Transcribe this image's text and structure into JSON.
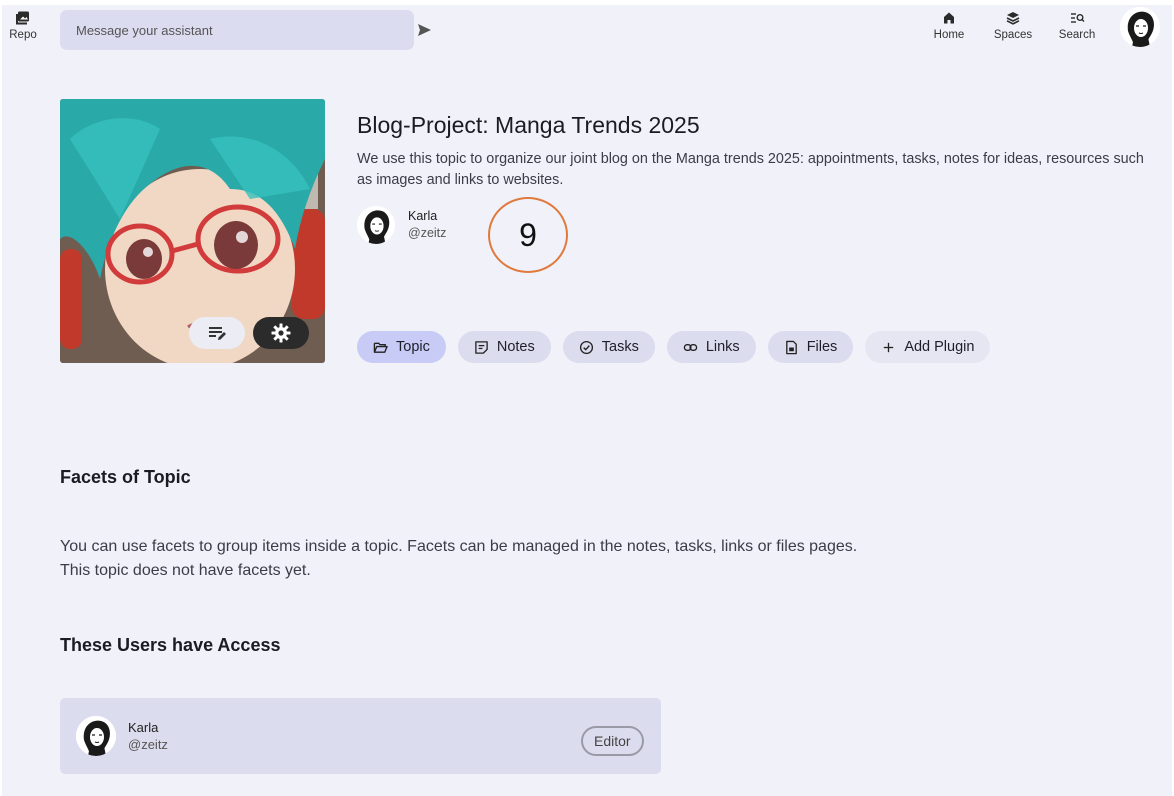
{
  "topbar": {
    "repo_label": "Repo",
    "message_placeholder": "Message your assistant",
    "nav": {
      "home": "Home",
      "spaces": "Spaces",
      "search": "Search"
    }
  },
  "topic": {
    "title": "Blog-Project: Manga Trends 2025",
    "description": "We use this topic to organize our joint blog on the Manga trends 2025: appointments, tasks, notes for ideas, resources such as images and links to websites.",
    "owner": {
      "name": "Karla",
      "handle": "@zeitz"
    },
    "badge": "9"
  },
  "tabs": [
    {
      "label": "Topic",
      "icon": "folder-open-icon",
      "active": true
    },
    {
      "label": "Notes",
      "icon": "note-icon",
      "active": false
    },
    {
      "label": "Tasks",
      "icon": "check-circle-icon",
      "active": false
    },
    {
      "label": "Links",
      "icon": "link-icon",
      "active": false
    },
    {
      "label": "Files",
      "icon": "file-icon",
      "active": false
    },
    {
      "label": "Add Plugin",
      "icon": "plus-icon",
      "active": false
    }
  ],
  "facets": {
    "heading": "Facets of Topic",
    "line1": "You can use facets to group items inside a topic. Facets can be managed in the notes, tasks, links or files pages.",
    "line2": "This topic does not have facets yet."
  },
  "access": {
    "heading": "These Users have Access",
    "users": [
      {
        "name": "Karla",
        "handle": "@zeitz",
        "role": "Editor"
      }
    ]
  },
  "colors": {
    "background": "#f1f1f9",
    "tab": "#dcdcef",
    "tab_active": "#c8cbf6",
    "badge_ring": "#e07a3c"
  }
}
